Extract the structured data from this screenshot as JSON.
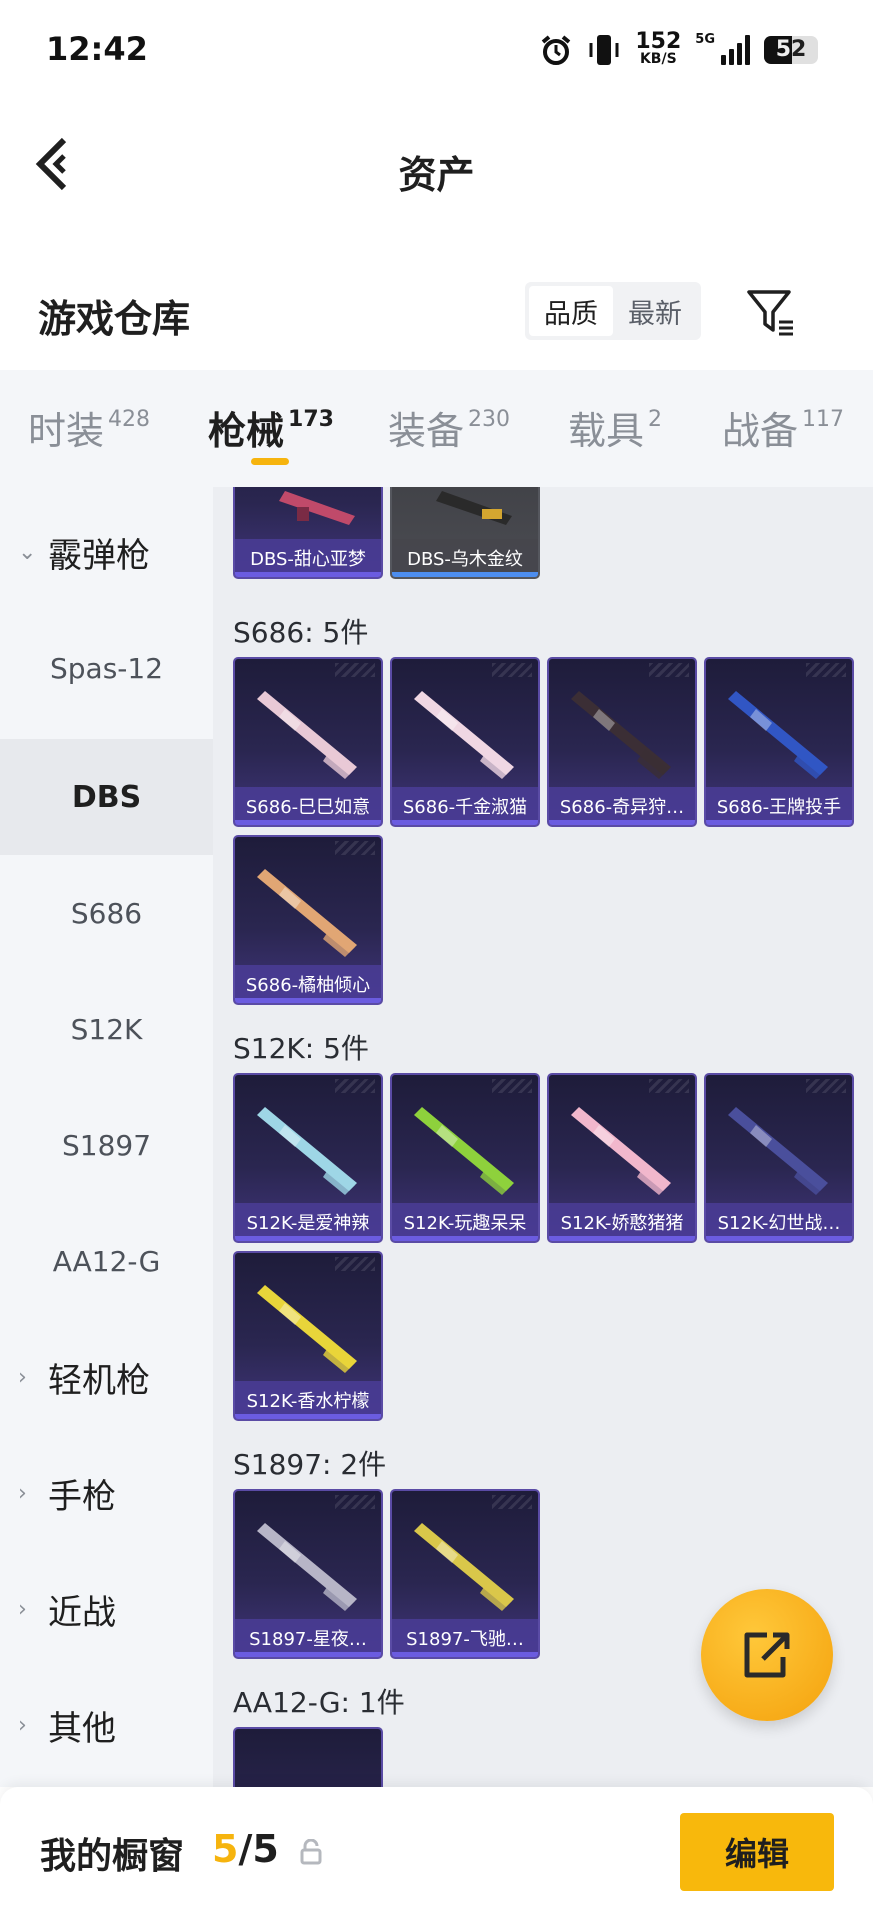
{
  "status_bar": {
    "time": "12:42",
    "net_speed_value": "152",
    "net_speed_unit": "KB/S",
    "network_type": "5G",
    "battery": "52",
    "icons": [
      "alarm-icon",
      "vibrate-icon",
      "signal-icon",
      "battery-icon"
    ]
  },
  "header": {
    "title": "资产",
    "back_icon": "chevron-left-icon"
  },
  "repository": {
    "title": "游戏仓库",
    "sort_options": [
      {
        "label": "品质",
        "active": true
      },
      {
        "label": "最新",
        "active": false
      }
    ],
    "filter_icon": "filter-icon"
  },
  "tabs": [
    {
      "label": "时装",
      "count": "428",
      "active": false
    },
    {
      "label": "枪械",
      "count": "173",
      "active": true
    },
    {
      "label": "装备",
      "count": "230",
      "active": false
    },
    {
      "label": "载具",
      "count": "2",
      "active": false
    },
    {
      "label": "战备",
      "count": "117",
      "active": false
    }
  ],
  "sidebar": {
    "items": [
      {
        "label": "霰弹枪",
        "type": "group",
        "expanded": true
      },
      {
        "label": "Spas-12",
        "type": "sub"
      },
      {
        "label": "DBS",
        "type": "sub",
        "active": true
      },
      {
        "label": "S686",
        "type": "sub"
      },
      {
        "label": "S12K",
        "type": "sub"
      },
      {
        "label": "S1897",
        "type": "sub"
      },
      {
        "label": "AA12-G",
        "type": "sub"
      },
      {
        "label": "轻机枪",
        "type": "group",
        "expanded": false
      },
      {
        "label": "手枪",
        "type": "group",
        "expanded": false
      },
      {
        "label": "近战",
        "type": "group",
        "expanded": false
      },
      {
        "label": "其他",
        "type": "group",
        "expanded": false
      }
    ]
  },
  "content": {
    "dbs_partial": [
      {
        "label": "DBS-甜心亚梦",
        "style": "purple"
      },
      {
        "label": "DBS-乌木金纹",
        "style": "gray"
      }
    ],
    "groups": [
      {
        "title": "S686: 5件",
        "items": [
          {
            "label": "S686-巳巳如意",
            "gun": "#e8c9d6"
          },
          {
            "label": "S686-千金淑猫",
            "gun": "#f0d7e3"
          },
          {
            "label": "S686-奇异狩…",
            "gun": "#3b2e35"
          },
          {
            "label": "S686-王牌投手",
            "gun": "#3156c4"
          },
          {
            "label": "S686-橘柚倾心",
            "gun": "#e1a674"
          }
        ]
      },
      {
        "title": "S12K: 5件",
        "items": [
          {
            "label": "S12K-是爱神辣",
            "gun": "#9ed6e6"
          },
          {
            "label": "S12K-玩趣呆呆",
            "gun": "#8ed13c"
          },
          {
            "label": "S12K-娇憨猪猪",
            "gun": "#f1b7cc"
          },
          {
            "label": "S12K-幻世战…",
            "gun": "#4a4f9c"
          },
          {
            "label": "S12K-香水柠檬",
            "gun": "#e8d53a"
          }
        ]
      },
      {
        "title": "S1897: 2件",
        "items": [
          {
            "label": "S1897-星夜…",
            "gun": "#b7b5c7"
          },
          {
            "label": "S1897-飞驰…",
            "gun": "#d9c74a"
          }
        ]
      },
      {
        "title": "AA12-G: 1件",
        "items": []
      }
    ]
  },
  "fab": {
    "icon": "share-icon"
  },
  "bottom_bar": {
    "title": "我的橱窗",
    "count_current": "5",
    "count_sep": "/",
    "count_total": "5",
    "lock_icon": "lock-icon",
    "edit_label": "编辑"
  },
  "colors": {
    "accent": "#f6b40e",
    "card_purple": "#2a2650",
    "sidebar_bg": "#f4f6f9",
    "content_bg": "#eceef2"
  }
}
